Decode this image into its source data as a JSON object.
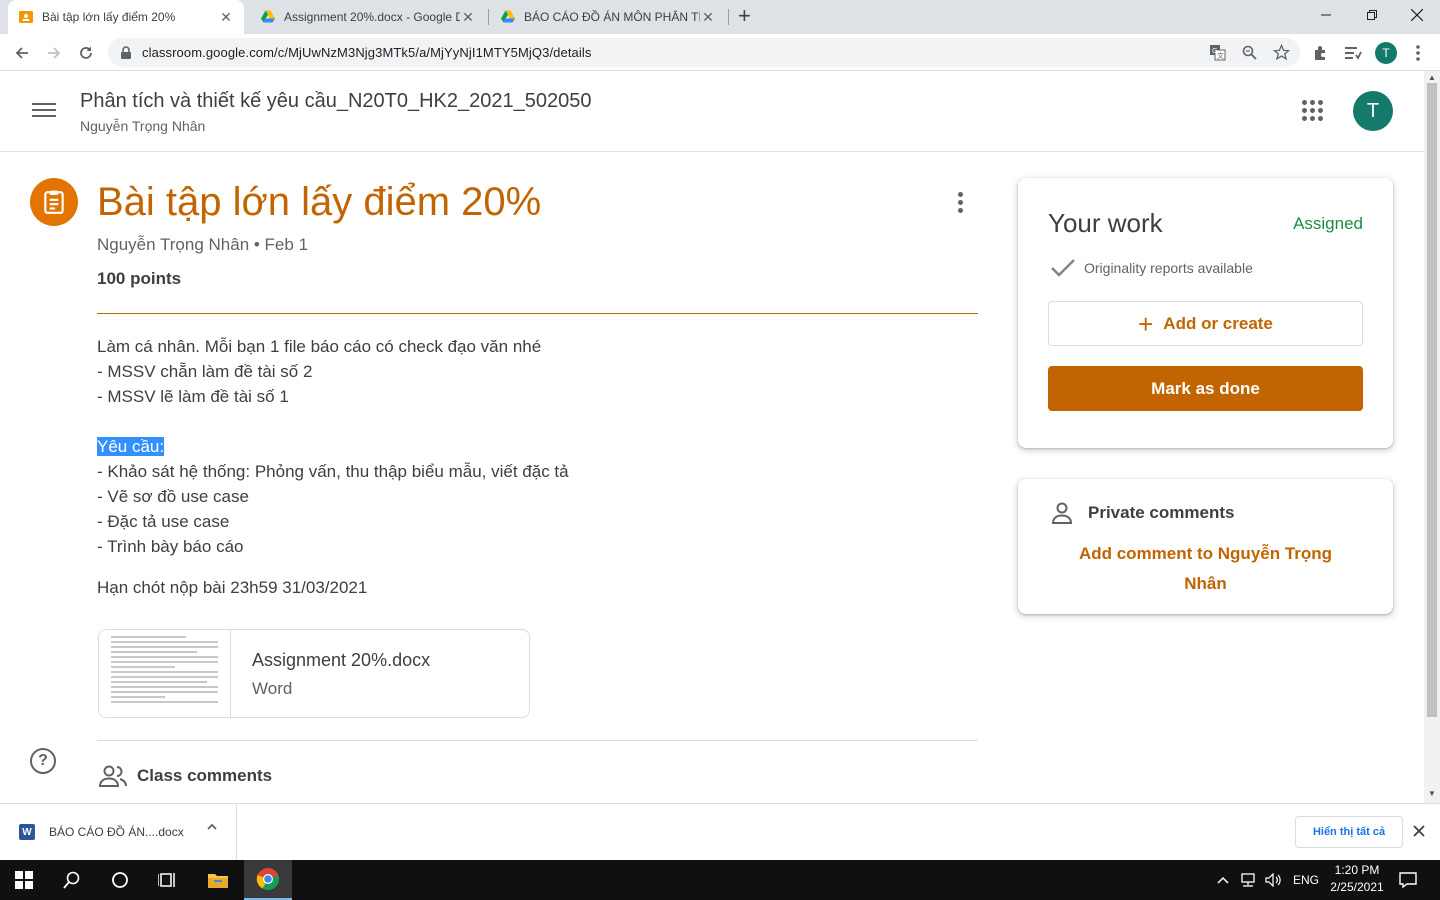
{
  "browser": {
    "tabs": [
      {
        "title": "Bài tập lớn lấy điểm 20%",
        "active": true,
        "favicon": "classroom-icon"
      },
      {
        "title": "Assignment 20%.docx - Google D",
        "active": false,
        "favicon": "drive-icon"
      },
      {
        "title": "BÁO CÁO ĐỒ ÁN MÔN PHÂN TÍ",
        "active": false,
        "favicon": "drive-icon"
      }
    ],
    "new_tab": "+",
    "url": "classroom.google.com/c/MjUwNzM3Njg3MTk5/a/MjYyNjI1MTY5MjQ3/details",
    "profile_initial": "T"
  },
  "header": {
    "class_title": "Phân tích và thiết kế yêu cầu_N20T0_HK2_2021_502050",
    "teacher": "Nguyễn Trọng Nhân",
    "avatar_initial": "T"
  },
  "assignment": {
    "title": "Bài tập lớn lấy điểm 20%",
    "meta": "Nguyễn Trọng Nhân • Feb 1",
    "points": "100 points",
    "description": {
      "intro": "Làm cá nhân. Mỗi bạn 1 file báo cáo có check đạo văn nhé",
      "line2": "- MSSV chẵn làm đề tài số 2",
      "line3": "- MSSV lẽ làm đề tài số 1",
      "req_heading": "Yêu cầu:",
      "req1": "- Khảo sát hệ thống: Phỏng vấn, thu thập biểu mẫu, viết đặc tả",
      "req2": "- Vẽ sơ đồ use case",
      "req3": "- Đặc tả use case",
      "req4": "- Trình bày báo cáo",
      "deadline": "Hạn chót nộp bài 23h59 31/03/2021"
    },
    "attachment": {
      "name": "Assignment 20%.docx",
      "type": "Word"
    },
    "class_comments": "Class comments"
  },
  "your_work": {
    "title": "Your work",
    "status": "Assigned",
    "originality": "Originality reports available",
    "add_button": "Add or create",
    "done_button": "Mark as done"
  },
  "private_comments": {
    "title": "Private comments",
    "add_link": "Add comment to Nguyễn Trọng Nhân"
  },
  "download_bar": {
    "file": "BÁO CÁO ĐỒ ÁN....docx",
    "show_all": "Hiển thị tất cả"
  },
  "taskbar": {
    "language": "ENG",
    "time": "1:20 PM",
    "date": "2/25/2021"
  },
  "colors": {
    "accent": "#c26401",
    "assigned": "#1e8e3e",
    "avatar": "#137a6c"
  }
}
